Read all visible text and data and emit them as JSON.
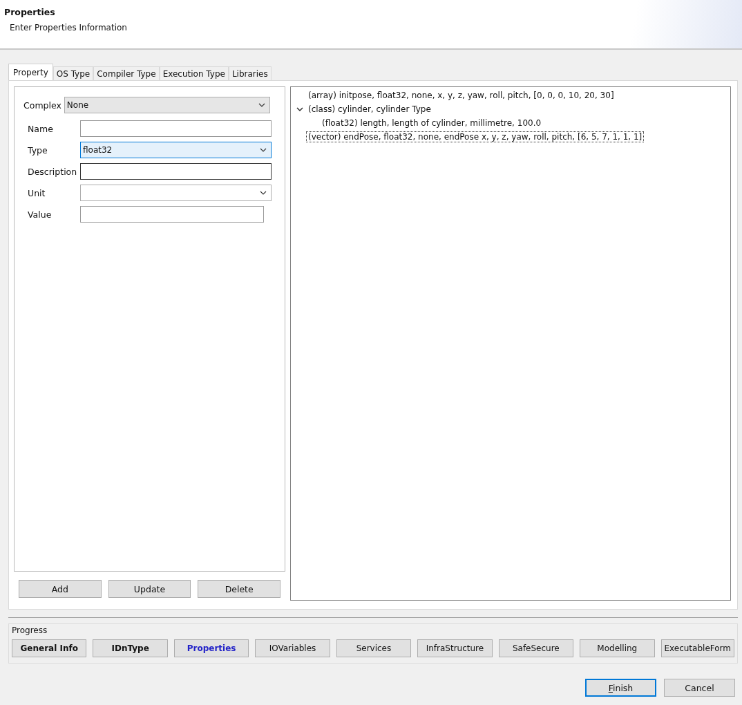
{
  "header": {
    "title": "Properties",
    "subtitle": "Enter Properties Information"
  },
  "tabs": [
    {
      "label": "Property",
      "selected": true
    },
    {
      "label": "OS Type",
      "selected": false
    },
    {
      "label": "Compiler Type",
      "selected": false
    },
    {
      "label": "Execution Type",
      "selected": false
    },
    {
      "label": "Libraries",
      "selected": false
    }
  ],
  "complex": {
    "label": "Complex",
    "value": "None"
  },
  "fields": [
    {
      "label": "Name",
      "kind": "text",
      "focused": false
    },
    {
      "label": "Type",
      "kind": "select",
      "value": "float32",
      "focused": true
    },
    {
      "label": "Description",
      "kind": "text",
      "focused": false
    },
    {
      "label": "Unit",
      "kind": "select",
      "focused": false
    },
    {
      "label": "Value",
      "kind": "text",
      "focused": false
    }
  ],
  "form_buttons": [
    "Add",
    "Update",
    "Delete"
  ],
  "tree": [
    {
      "text": "(array) initpose, float32, none, x, y, z, yaw, roll, pitch, [0, 0, 0, 10, 20, 30]",
      "focused": false
    },
    {
      "text": "(class) cylinder, cylinder Type",
      "expanded": true,
      "focused": false,
      "children": [
        {
          "text": "(float32) length, length of cylinder, millimetre, 100.0",
          "focused": false
        }
      ]
    },
    {
      "text": "(vector) endPose, float32, none, endPose x, y, z, yaw, roll, pitch, [6, 5, 7, 1, 1, 1]",
      "focused": true
    }
  ],
  "progress": {
    "label": "Progress",
    "steps": [
      {
        "label": "General Info",
        "completed": true,
        "selected": false
      },
      {
        "label": "IDnType",
        "completed": true,
        "selected": false
      },
      {
        "label": "Properties",
        "completed": false,
        "selected": true
      },
      {
        "label": "IOVariables",
        "completed": false,
        "selected": false
      },
      {
        "label": "Services",
        "completed": false,
        "selected": false
      },
      {
        "label": "InfraStructure",
        "completed": false,
        "selected": false
      },
      {
        "label": "SafeSecure",
        "completed": false,
        "selected": false
      },
      {
        "label": "Modelling",
        "completed": false,
        "selected": false
      },
      {
        "label": "ExecutableForm",
        "completed": false,
        "selected": false
      }
    ]
  },
  "dialog_buttons": [
    {
      "label": "Finish",
      "default": true
    },
    {
      "label": "Cancel",
      "default": false
    }
  ]
}
